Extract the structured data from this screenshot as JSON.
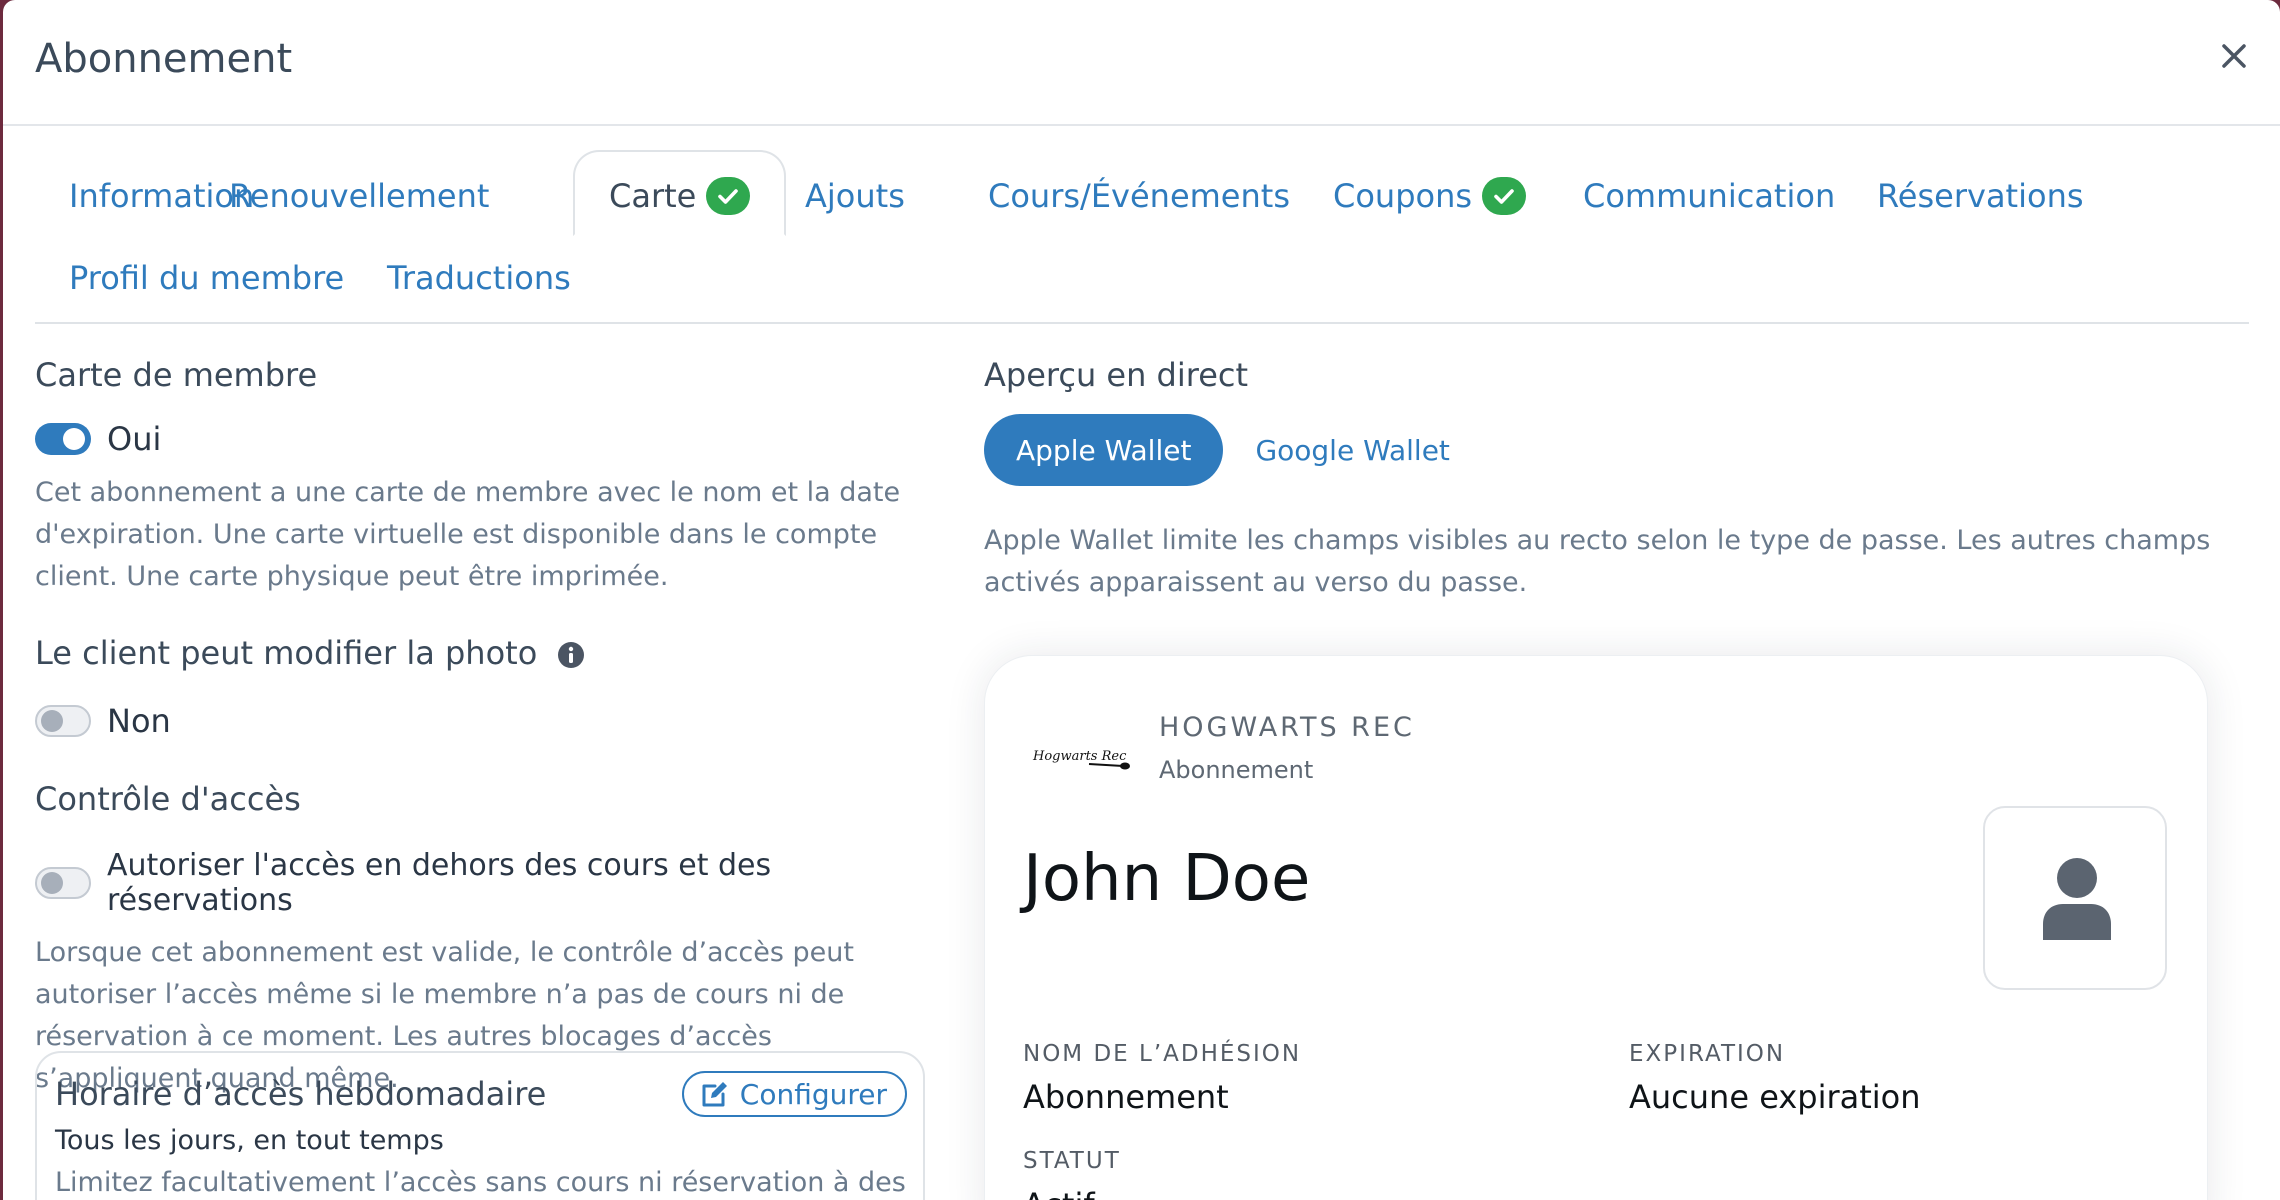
{
  "modal": {
    "title": "Abonnement"
  },
  "tabs": [
    {
      "label": "Information",
      "active": false,
      "checked": false
    },
    {
      "label": "Renouvellement",
      "active": false,
      "checked": false
    },
    {
      "label": "Carte",
      "active": true,
      "checked": true
    },
    {
      "label": "Ajouts",
      "active": false,
      "checked": false
    },
    {
      "label": "Cours/Événements",
      "active": false,
      "checked": false
    },
    {
      "label": "Coupons",
      "active": false,
      "checked": true
    },
    {
      "label": "Communication",
      "active": false,
      "checked": false
    },
    {
      "label": "Réservations",
      "active": false,
      "checked": false
    },
    {
      "label": "Profil du membre",
      "active": false,
      "checked": false
    },
    {
      "label": "Traductions",
      "active": false,
      "checked": false
    }
  ],
  "member_card": {
    "title": "Carte de membre",
    "toggle_label": "Oui",
    "enabled": true,
    "help": "Cet abonnement a une carte de membre avec le nom et la date d'expiration. Une carte virtuelle est disponible dans le compte client. Une carte physique peut être imprimée."
  },
  "photo": {
    "title": "Le client peut modifier la photo",
    "toggle_label": "Non",
    "enabled": false
  },
  "access_control": {
    "title": "Contrôle d'accès",
    "toggle_label": "Autoriser l'accès en dehors des cours et des réservations",
    "enabled": false,
    "help": "Lorsque cet abonnement est valide, le contrôle d’accès peut autoriser l’accès même si le membre n’a pas de cours ni de réservation à ce moment. Les autres blocages d’accès s’appliquent quand même."
  },
  "weekly_schedule": {
    "title": "Horaire d’accès hebdomadaire",
    "configure_label": "Configurer",
    "summary": "Tous les jours, en tout temps",
    "help": "Limitez facultativement l’accès sans cours ni réservation à des"
  },
  "preview": {
    "title": "Aperçu en direct",
    "apple_label": "Apple Wallet",
    "google_label": "Google Wallet",
    "selected": "Apple Wallet",
    "help": "Apple Wallet limite les champs visibles au recto selon le type de passe. Les autres champs activés apparaissent au verso du passe."
  },
  "pass": {
    "logo_text": "Hogwarts Rec",
    "organization": "HOGWARTS REC",
    "type": "Abonnement",
    "member_name": "John Doe",
    "membership_label": "NOM DE L’ADHÉSION",
    "membership_value": "Abonnement",
    "expiration_label": "EXPIRATION",
    "expiration_value": "Aucune expiration",
    "status_label": "STATUT",
    "status_value": "Actif"
  },
  "colors": {
    "accent": "#2f7bbd",
    "success": "#2fa84f",
    "text": "#3b4a5a",
    "muted": "#6a7a8c",
    "backdrop": "#6d2a3e"
  },
  "icons": {
    "close": "close-icon",
    "check": "check-circle-icon",
    "info": "info-icon",
    "edit": "edit-icon",
    "avatar": "user-icon"
  }
}
